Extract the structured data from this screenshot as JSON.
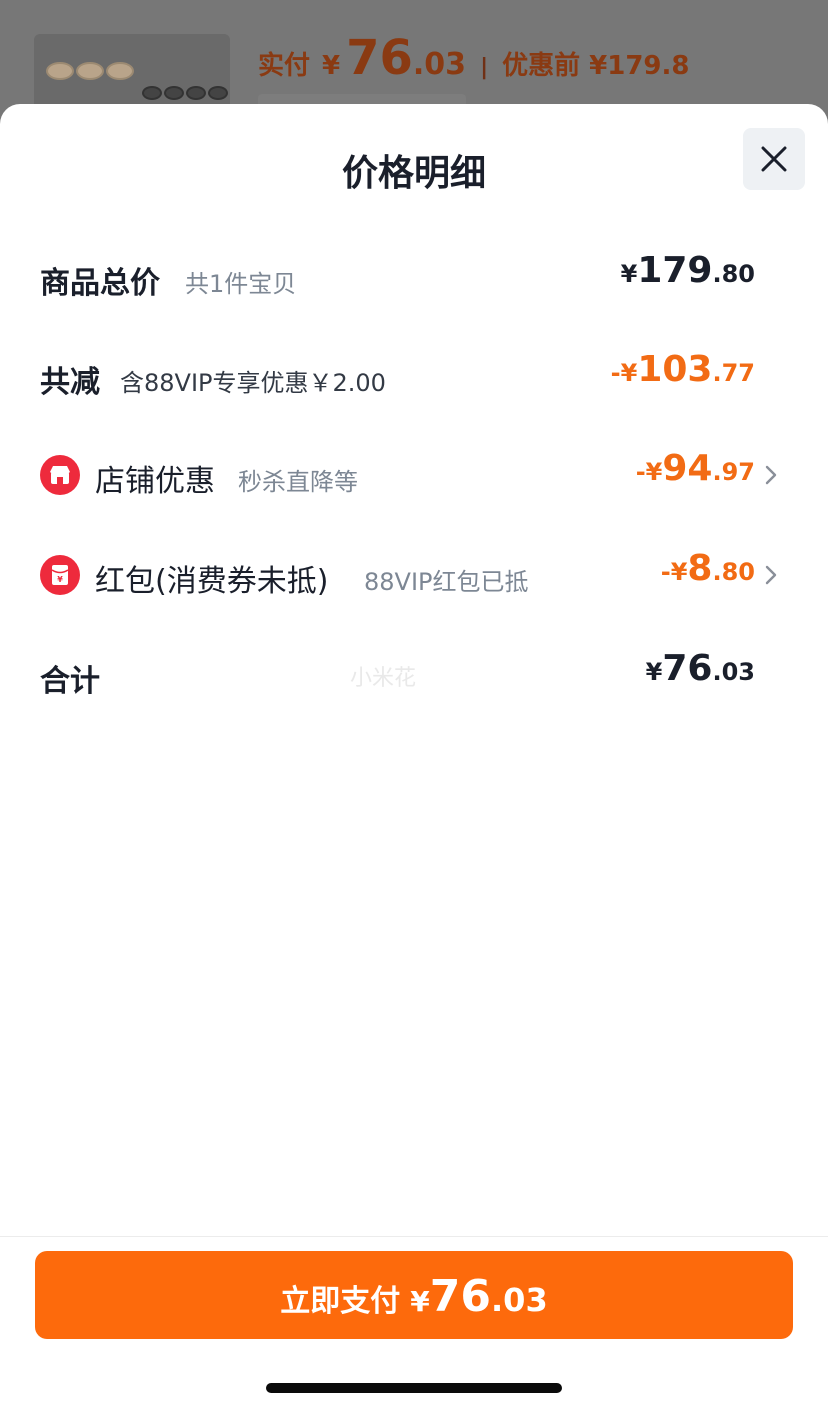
{
  "background": {
    "actual_label": "实付",
    "yen": "¥",
    "actual_int": "76",
    "actual_dec": ".03",
    "separator": "|",
    "original_label": "优惠前 ¥179.8"
  },
  "sheet": {
    "title": "价格明细",
    "close_icon": "close-icon"
  },
  "rows": {
    "total_goods": {
      "label": "商品总价",
      "sub": "共1件宝贝",
      "yen": "¥",
      "int": "179",
      "dec": ".80"
    },
    "total_reduce": {
      "label": "共减",
      "sub": "含88VIP专享优惠￥2.00",
      "sign_yen": "-¥",
      "int": "103",
      "dec": ".77"
    },
    "store_discount": {
      "icon": "store-icon",
      "label": "店铺优惠",
      "sub": "秒杀直降等",
      "sign_yen": "-¥",
      "int": "94",
      "dec": ".97"
    },
    "red_packet": {
      "icon": "red-packet-icon",
      "label": "红包(消费券未抵)",
      "sub": "88VIP红包已抵",
      "sign_yen": "-¥",
      "int": "8",
      "dec": ".80"
    },
    "sum": {
      "label": "合计",
      "yen": "¥",
      "int": "76",
      "dec": ".03"
    }
  },
  "watermark": "小米花",
  "pay_button": {
    "label": "立即支付",
    "yen": "¥",
    "int": "76",
    "dec": ".03"
  },
  "colors": {
    "accent": "#fd6a0c",
    "discount": "#f26b14",
    "icon_red": "#ee2a3c"
  }
}
